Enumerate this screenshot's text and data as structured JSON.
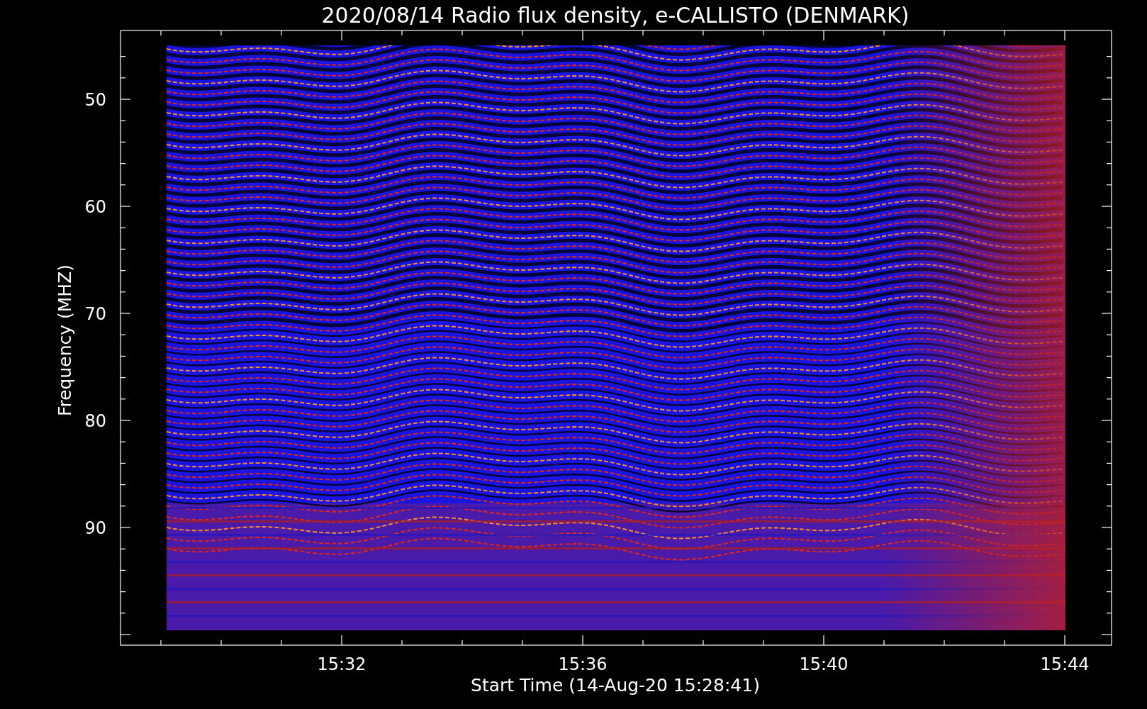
{
  "title": "2020/08/14  Radio flux density, e-CALLISTO (DENMARK)",
  "y_axis": {
    "label": "Frequency (MHZ)",
    "tick_labels": [
      "50",
      "60",
      "70",
      "80",
      "90"
    ]
  },
  "x_axis": {
    "label": "Start Time (14-Aug-20 15:28:41)",
    "tick_labels": [
      "15:32",
      "15:36",
      "15:40",
      "15:44"
    ]
  }
}
